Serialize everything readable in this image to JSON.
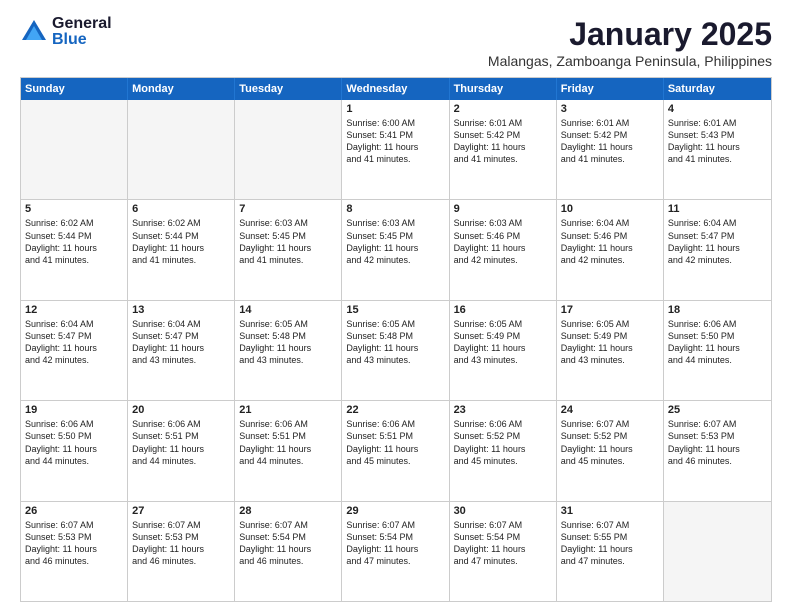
{
  "logo": {
    "general": "General",
    "blue": "Blue"
  },
  "title": "January 2025",
  "location": "Malangas, Zamboanga Peninsula, Philippines",
  "weekdays": [
    "Sunday",
    "Monday",
    "Tuesday",
    "Wednesday",
    "Thursday",
    "Friday",
    "Saturday"
  ],
  "rows": [
    [
      {
        "day": "",
        "lines": [],
        "empty": true
      },
      {
        "day": "",
        "lines": [],
        "empty": true
      },
      {
        "day": "",
        "lines": [],
        "empty": true
      },
      {
        "day": "1",
        "lines": [
          "Sunrise: 6:00 AM",
          "Sunset: 5:41 PM",
          "Daylight: 11 hours",
          "and 41 minutes."
        ]
      },
      {
        "day": "2",
        "lines": [
          "Sunrise: 6:01 AM",
          "Sunset: 5:42 PM",
          "Daylight: 11 hours",
          "and 41 minutes."
        ]
      },
      {
        "day": "3",
        "lines": [
          "Sunrise: 6:01 AM",
          "Sunset: 5:42 PM",
          "Daylight: 11 hours",
          "and 41 minutes."
        ]
      },
      {
        "day": "4",
        "lines": [
          "Sunrise: 6:01 AM",
          "Sunset: 5:43 PM",
          "Daylight: 11 hours",
          "and 41 minutes."
        ]
      }
    ],
    [
      {
        "day": "5",
        "lines": [
          "Sunrise: 6:02 AM",
          "Sunset: 5:44 PM",
          "Daylight: 11 hours",
          "and 41 minutes."
        ]
      },
      {
        "day": "6",
        "lines": [
          "Sunrise: 6:02 AM",
          "Sunset: 5:44 PM",
          "Daylight: 11 hours",
          "and 41 minutes."
        ]
      },
      {
        "day": "7",
        "lines": [
          "Sunrise: 6:03 AM",
          "Sunset: 5:45 PM",
          "Daylight: 11 hours",
          "and 41 minutes."
        ]
      },
      {
        "day": "8",
        "lines": [
          "Sunrise: 6:03 AM",
          "Sunset: 5:45 PM",
          "Daylight: 11 hours",
          "and 42 minutes."
        ]
      },
      {
        "day": "9",
        "lines": [
          "Sunrise: 6:03 AM",
          "Sunset: 5:46 PM",
          "Daylight: 11 hours",
          "and 42 minutes."
        ]
      },
      {
        "day": "10",
        "lines": [
          "Sunrise: 6:04 AM",
          "Sunset: 5:46 PM",
          "Daylight: 11 hours",
          "and 42 minutes."
        ]
      },
      {
        "day": "11",
        "lines": [
          "Sunrise: 6:04 AM",
          "Sunset: 5:47 PM",
          "Daylight: 11 hours",
          "and 42 minutes."
        ]
      }
    ],
    [
      {
        "day": "12",
        "lines": [
          "Sunrise: 6:04 AM",
          "Sunset: 5:47 PM",
          "Daylight: 11 hours",
          "and 42 minutes."
        ]
      },
      {
        "day": "13",
        "lines": [
          "Sunrise: 6:04 AM",
          "Sunset: 5:47 PM",
          "Daylight: 11 hours",
          "and 43 minutes."
        ]
      },
      {
        "day": "14",
        "lines": [
          "Sunrise: 6:05 AM",
          "Sunset: 5:48 PM",
          "Daylight: 11 hours",
          "and 43 minutes."
        ]
      },
      {
        "day": "15",
        "lines": [
          "Sunrise: 6:05 AM",
          "Sunset: 5:48 PM",
          "Daylight: 11 hours",
          "and 43 minutes."
        ]
      },
      {
        "day": "16",
        "lines": [
          "Sunrise: 6:05 AM",
          "Sunset: 5:49 PM",
          "Daylight: 11 hours",
          "and 43 minutes."
        ]
      },
      {
        "day": "17",
        "lines": [
          "Sunrise: 6:05 AM",
          "Sunset: 5:49 PM",
          "Daylight: 11 hours",
          "and 43 minutes."
        ]
      },
      {
        "day": "18",
        "lines": [
          "Sunrise: 6:06 AM",
          "Sunset: 5:50 PM",
          "Daylight: 11 hours",
          "and 44 minutes."
        ]
      }
    ],
    [
      {
        "day": "19",
        "lines": [
          "Sunrise: 6:06 AM",
          "Sunset: 5:50 PM",
          "Daylight: 11 hours",
          "and 44 minutes."
        ]
      },
      {
        "day": "20",
        "lines": [
          "Sunrise: 6:06 AM",
          "Sunset: 5:51 PM",
          "Daylight: 11 hours",
          "and 44 minutes."
        ]
      },
      {
        "day": "21",
        "lines": [
          "Sunrise: 6:06 AM",
          "Sunset: 5:51 PM",
          "Daylight: 11 hours",
          "and 44 minutes."
        ]
      },
      {
        "day": "22",
        "lines": [
          "Sunrise: 6:06 AM",
          "Sunset: 5:51 PM",
          "Daylight: 11 hours",
          "and 45 minutes."
        ]
      },
      {
        "day": "23",
        "lines": [
          "Sunrise: 6:06 AM",
          "Sunset: 5:52 PM",
          "Daylight: 11 hours",
          "and 45 minutes."
        ]
      },
      {
        "day": "24",
        "lines": [
          "Sunrise: 6:07 AM",
          "Sunset: 5:52 PM",
          "Daylight: 11 hours",
          "and 45 minutes."
        ]
      },
      {
        "day": "25",
        "lines": [
          "Sunrise: 6:07 AM",
          "Sunset: 5:53 PM",
          "Daylight: 11 hours",
          "and 46 minutes."
        ]
      }
    ],
    [
      {
        "day": "26",
        "lines": [
          "Sunrise: 6:07 AM",
          "Sunset: 5:53 PM",
          "Daylight: 11 hours",
          "and 46 minutes."
        ]
      },
      {
        "day": "27",
        "lines": [
          "Sunrise: 6:07 AM",
          "Sunset: 5:53 PM",
          "Daylight: 11 hours",
          "and 46 minutes."
        ]
      },
      {
        "day": "28",
        "lines": [
          "Sunrise: 6:07 AM",
          "Sunset: 5:54 PM",
          "Daylight: 11 hours",
          "and 46 minutes."
        ]
      },
      {
        "day": "29",
        "lines": [
          "Sunrise: 6:07 AM",
          "Sunset: 5:54 PM",
          "Daylight: 11 hours",
          "and 47 minutes."
        ]
      },
      {
        "day": "30",
        "lines": [
          "Sunrise: 6:07 AM",
          "Sunset: 5:54 PM",
          "Daylight: 11 hours",
          "and 47 minutes."
        ]
      },
      {
        "day": "31",
        "lines": [
          "Sunrise: 6:07 AM",
          "Sunset: 5:55 PM",
          "Daylight: 11 hours",
          "and 47 minutes."
        ]
      },
      {
        "day": "",
        "lines": [],
        "empty": true
      }
    ]
  ]
}
